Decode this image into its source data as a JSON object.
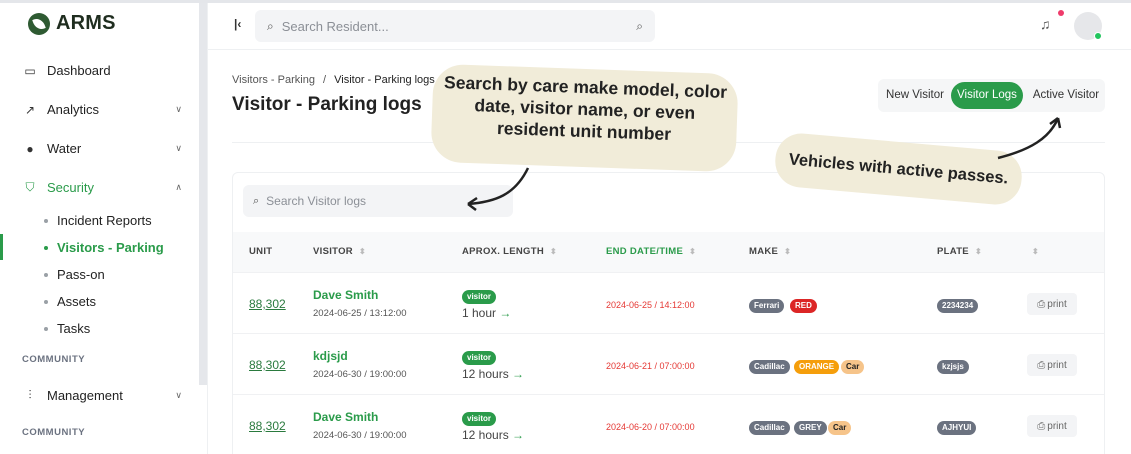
{
  "brand": {
    "name": "ARMS"
  },
  "sidebar": {
    "items": [
      {
        "label": "Dashboard",
        "icon": "monitor-icon"
      },
      {
        "label": "Analytics",
        "icon": "trend-icon"
      },
      {
        "label": "Water",
        "icon": "drop-icon"
      },
      {
        "label": "Security",
        "icon": "shield-icon"
      }
    ],
    "security_sub": [
      "Incident Reports",
      "Visitors - Parking",
      "Pass-on",
      "Assets",
      "Tasks"
    ],
    "section1": "COMMUNITY",
    "management": "Management",
    "section2": "COMMUNITY"
  },
  "header": {
    "search_placeholder": "Search Resident..."
  },
  "page": {
    "breadcrumb_parent": "Visitors - Parking",
    "breadcrumb_sep": "/",
    "breadcrumb_current": "Visitor - Parking logs",
    "title": "Visitor - Parking logs"
  },
  "tabs": [
    "New Visitor",
    "Visitor Logs",
    "Active Visitor"
  ],
  "logs_search_placeholder": "Search Visitor logs",
  "table": {
    "columns": [
      "UNIT",
      "VISITOR",
      "APROX. LENGTH",
      "END DATE/TIME",
      "MAKE",
      "PLATE"
    ],
    "rows": [
      {
        "unit": "88,302",
        "visitor": "Dave Smith",
        "date": "2024-06-25 / 13:12:00",
        "badge": "visitor",
        "length": "1 hour",
        "end": "2024-06-25 / 14:12:00",
        "make": [
          "Ferrari",
          "RED"
        ],
        "plate": "2234234",
        "print": "print"
      },
      {
        "unit": "88,302",
        "visitor": "kdjsjd",
        "date": "2024-06-30 / 19:00:00",
        "badge": "visitor",
        "length": "12 hours",
        "end": "2024-06-21 / 07:00:00",
        "make": [
          "Cadillac",
          "ORANGE",
          "Car"
        ],
        "plate": "kzjsjs",
        "print": "print"
      },
      {
        "unit": "88,302",
        "visitor": "Dave Smith",
        "date": "2024-06-30 / 19:00:00",
        "badge": "visitor",
        "length": "12 hours",
        "end": "2024-06-20 / 07:00:00",
        "make": [
          "Cadillac",
          "GREY",
          "Car"
        ],
        "plate": "AJHYUI",
        "print": "print"
      }
    ]
  },
  "annotations": {
    "search_tip": [
      "Search by care make model, color",
      "date, visitor name, or even",
      "resident unit number"
    ],
    "active_tip": "Vehicles with active passes."
  },
  "colors": {
    "accent": "#2a9b4a",
    "danger": "#e53935"
  }
}
